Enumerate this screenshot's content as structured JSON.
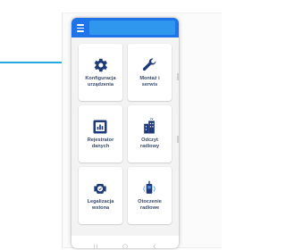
{
  "colors": {
    "appbar": "#1e73e8",
    "appbar_field": "#2f97ee",
    "tile_icon": "#1e3a7a",
    "tile_text": "#3a4a6b",
    "connector": "#29a8e0"
  },
  "appbar": {
    "menu_icon": "hamburger-icon",
    "title": ""
  },
  "tiles": [
    {
      "label_line1": "Konfiguracja",
      "label_line2": "urządzenia",
      "icon": "gear-icon"
    },
    {
      "label_line1": "Montaż i",
      "label_line2": "serwis",
      "icon": "wrench-icon"
    },
    {
      "label_line1": "Rejestrator",
      "label_line2": "danych",
      "icon": "data-logger-icon"
    },
    {
      "label_line1": "Odczyt",
      "label_line2": "radiowy",
      "icon": "building-icon"
    },
    {
      "label_line1": "Legalizacja",
      "label_line2": "wstona",
      "icon": "meter-icon"
    },
    {
      "label_line1": "Otoczenie",
      "label_line2": "radiowe",
      "icon": "radio-device-icon"
    }
  ],
  "navbar": {
    "back_icon": "back-icon",
    "home_icon": "home-icon",
    "recents_icon": "recents-icon"
  }
}
